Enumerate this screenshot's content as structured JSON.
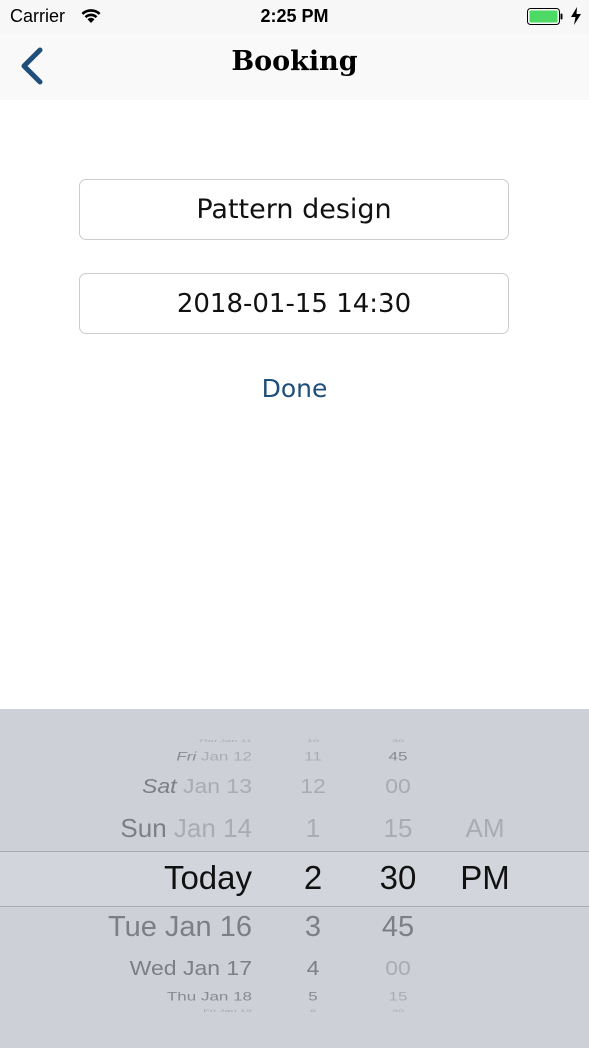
{
  "status_bar": {
    "carrier": "Carrier",
    "time": "2:25 PM",
    "battery_color": "#4cd964"
  },
  "nav": {
    "title": "Booking",
    "back_icon": "chevron-left-icon",
    "tint": "#1f4e7a"
  },
  "form": {
    "service_value": "Pattern design",
    "datetime_value": "2018-01-15 14:30",
    "done_label": "Done"
  },
  "picker": {
    "days": [
      {
        "weekday": "Thu",
        "date": "Jan 11"
      },
      {
        "weekday": "Fri",
        "date": "Jan 12"
      },
      {
        "weekday": "Sat",
        "date": "Jan 13"
      },
      {
        "weekday": "Sun",
        "date": "Jan 14"
      },
      {
        "weekday": "",
        "date": "Today"
      },
      {
        "weekday": "Tue",
        "date": "Jan 16"
      },
      {
        "weekday": "Wed",
        "date": "Jan 17"
      },
      {
        "weekday": "Thu",
        "date": "Jan 18"
      },
      {
        "weekday": "Fri",
        "date": "Jan 19"
      }
    ],
    "hours": [
      "10",
      "11",
      "12",
      "1",
      "2",
      "3",
      "4",
      "5",
      "6"
    ],
    "minutes": [
      "30",
      "45",
      "00",
      "15",
      "30",
      "45",
      "00",
      "15",
      "30"
    ],
    "ampm": [
      "",
      "",
      "",
      "AM",
      "PM",
      "",
      "",
      "",
      ""
    ],
    "selected": {
      "day": "Today",
      "hour": "2",
      "minute": "30",
      "period": "PM"
    }
  }
}
